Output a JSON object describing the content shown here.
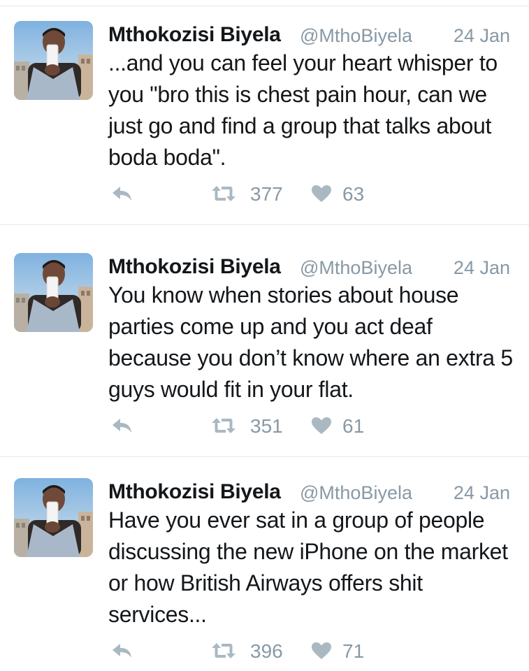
{
  "colors": {
    "text": "#14171a",
    "secondary": "#8899a6",
    "icon": "#aab8c2",
    "divider": "#e1e8ed"
  },
  "icons": {
    "reply": "reply-arrow-icon",
    "retweet": "retweet-icon",
    "like": "heart-icon"
  },
  "tweets": [
    {
      "author_name": "Mthokozisi Biyela",
      "handle": "@MthoBiyela",
      "date": "24 Jan",
      "text": "You know when stories about house parties come up and you act deaf because you don’t know where an extra 5 guys would fit in your flat.",
      "retweets": "351",
      "likes": "61"
    },
    {
      "author_name": "Mthokozisi Biyela",
      "handle": "@MthoBiyela",
      "date": "24 Jan",
      "text": "Have you ever sat in a group of people discussing the new iPhone on the market or how British Airways offers shit services...",
      "retweets": "396",
      "likes": "71"
    },
    {
      "author_name": "Mthokozisi Biyela",
      "handle": "@MthoBiyela",
      "date": "24 Jan",
      "text": "...and you can feel your heart whisper to you \"bro this is chest pain hour, can we just go and find a group that talks about boda boda\".",
      "retweets": "377",
      "likes": "63"
    }
  ]
}
